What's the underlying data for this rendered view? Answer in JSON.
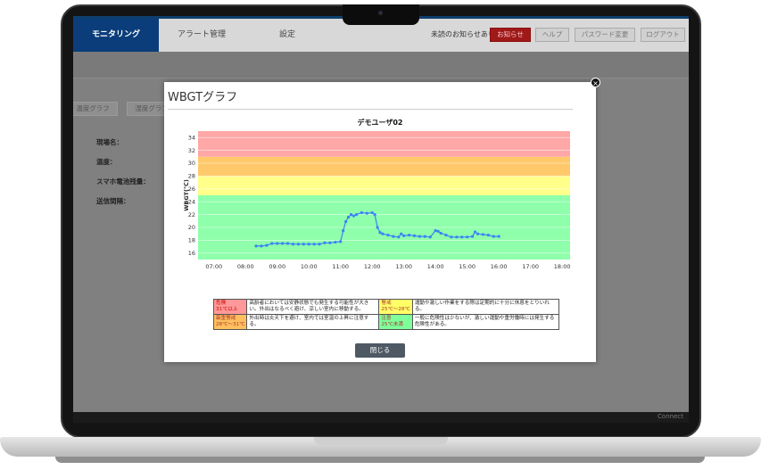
{
  "topbar": {
    "tabs": [
      {
        "label": "モニタリング",
        "active": true
      },
      {
        "label": "アラート管理",
        "active": false
      },
      {
        "label": "設定",
        "active": false
      }
    ],
    "notice": "未読のお知らせあり",
    "buttons": {
      "notifications": "お知らせ",
      "help": "ヘルプ",
      "password": "パスワード変更",
      "logout": "ログアウト"
    }
  },
  "subtabs": [
    "温度グラフ",
    "湿度グラフ"
  ],
  "fields": [
    "現場名：",
    "温度：",
    "スマホ電池残量：",
    "送信間隔："
  ],
  "chin_label": "Connect",
  "modal": {
    "title": "WBGTグラフ",
    "close_label": "閉じる",
    "close_icon": "×"
  },
  "chart_data": {
    "type": "line",
    "title": "デモユーザ02",
    "ylabel": "WBGT(℃)",
    "xlabel": "",
    "ylim": [
      15,
      35
    ],
    "yticks": [
      16,
      18,
      20,
      22,
      24,
      26,
      28,
      30,
      32,
      34
    ],
    "xlim": [
      "06:30",
      "18:15"
    ],
    "xticks": [
      "07:00",
      "08:00",
      "09:00",
      "10:00",
      "11:00",
      "12:00",
      "13:00",
      "14:00",
      "15:00",
      "16:00",
      "17:00",
      "18:00"
    ],
    "bands": [
      {
        "from": 15,
        "to": 25,
        "color": "#8fffab"
      },
      {
        "from": 25,
        "to": 28,
        "color": "#ffff8a"
      },
      {
        "from": 28,
        "to": 31,
        "color": "#ffc96b"
      },
      {
        "from": 31,
        "to": 35,
        "color": "#ffa7a7"
      }
    ],
    "series": [
      {
        "color": "#3b82f6",
        "x": [
          "08:20",
          "08:30",
          "08:40",
          "08:50",
          "09:00",
          "09:10",
          "09:20",
          "09:30",
          "09:40",
          "09:50",
          "10:00",
          "10:10",
          "10:20",
          "10:30",
          "10:40",
          "10:50",
          "11:00",
          "11:05",
          "11:10",
          "11:15",
          "11:20",
          "11:25",
          "11:30",
          "11:40",
          "11:50",
          "12:00",
          "12:05",
          "12:10",
          "12:15",
          "12:20",
          "12:30",
          "12:40",
          "12:50",
          "12:55",
          "13:00",
          "13:10",
          "13:20",
          "13:30",
          "13:40",
          "13:50",
          "14:00",
          "14:05",
          "14:10",
          "14:20",
          "14:30",
          "14:40",
          "14:50",
          "15:00",
          "15:10",
          "15:15",
          "15:20",
          "15:30",
          "15:40",
          "15:50",
          "16:00"
        ],
        "values": [
          17.1,
          17.1,
          17.2,
          17.5,
          17.5,
          17.5,
          17.5,
          17.4,
          17.4,
          17.4,
          17.4,
          17.4,
          17.4,
          17.6,
          17.6,
          17.7,
          17.8,
          19.5,
          20.9,
          21.6,
          22.0,
          21.8,
          22.0,
          22.3,
          22.2,
          22.3,
          22.0,
          20.0,
          19.2,
          19.0,
          18.8,
          18.6,
          18.5,
          19.0,
          18.7,
          18.8,
          18.7,
          18.6,
          18.6,
          18.5,
          19.5,
          19.4,
          19.1,
          18.8,
          18.5,
          18.5,
          18.5,
          18.5,
          18.6,
          19.3,
          19.0,
          18.9,
          18.8,
          18.6,
          18.6
        ]
      }
    ],
    "legend_table": [
      [
        {
          "level": "危険",
          "range": "31℃以上",
          "text": "高齢者においては安静状態でも発生する可能性が大きい。外出はなるべく避け、涼しい室内に移動する。"
        },
        {
          "level": "警戒",
          "range": "25℃～28℃",
          "text": "運動や激しい作業をする際は定期的に十分に休息をとりいれる。"
        }
      ],
      [
        {
          "level": "厳重警戒",
          "range": "28℃～31℃",
          "text": "外出時は炎天下を避け、室内では室温の上昇に注意する。"
        },
        {
          "level": "注意",
          "range": "25℃未満",
          "text": "一般に危険性は少ないが、激しい運動や重労働時には発生する危険性がある。"
        }
      ]
    ]
  }
}
